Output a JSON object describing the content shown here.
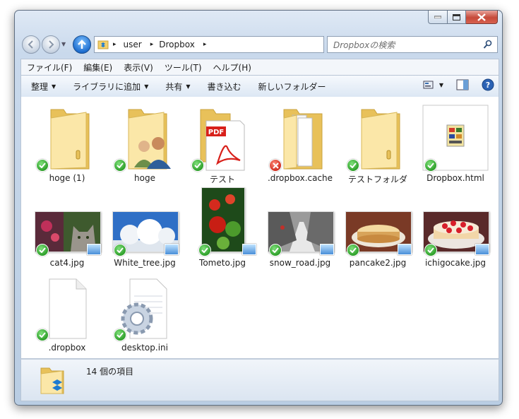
{
  "window": {
    "controls": [
      "minimize",
      "maximize",
      "close"
    ]
  },
  "address_bar": {
    "crumbs": [
      "user",
      "Dropbox"
    ],
    "separator": "▸"
  },
  "search": {
    "placeholder": "Dropboxの検索"
  },
  "menu": [
    "ファイル(F)",
    "編集(E)",
    "表示(V)",
    "ツール(T)",
    "ヘルプ(H)"
  ],
  "toolbar": {
    "organize": "整理",
    "include_library": "ライブラリに追加",
    "share": "共有",
    "burn": "書き込む",
    "new_folder": "新しいフォルダー"
  },
  "files": [
    {
      "name": "hoge (1)",
      "type": "folder",
      "sync": "ok"
    },
    {
      "name": "hoge",
      "type": "folder-users",
      "sync": "ok"
    },
    {
      "name": "テスト",
      "type": "pdf",
      "sync": "ok"
    },
    {
      "name": ".dropbox.cache",
      "type": "folder-docs",
      "sync": "error"
    },
    {
      "name": "テストフォルダ",
      "type": "folder",
      "sync": "ok"
    },
    {
      "name": "Dropbox.html",
      "type": "html",
      "sync": "ok"
    },
    {
      "name": "cat4.jpg",
      "type": "image",
      "sync": "ok"
    },
    {
      "name": "White_tree.jpg",
      "type": "image",
      "sync": "ok"
    },
    {
      "name": "Tometo.jpg",
      "type": "image",
      "sync": "ok"
    },
    {
      "name": "snow_road.jpg",
      "type": "image",
      "sync": "ok"
    },
    {
      "name": "pancake2.jpg",
      "type": "image",
      "sync": "ok"
    },
    {
      "name": "ichigocake.jpg",
      "type": "image",
      "sync": "ok"
    },
    {
      "name": ".dropbox",
      "type": "blank",
      "sync": "ok"
    },
    {
      "name": "desktop.ini",
      "type": "ini",
      "sync": "ok"
    }
  ],
  "status": {
    "text": "14 個の項目"
  },
  "colors": {
    "sync_ok": "#2e9f2a",
    "sync_error": "#d02d1f",
    "folder": "#f3d06b"
  }
}
